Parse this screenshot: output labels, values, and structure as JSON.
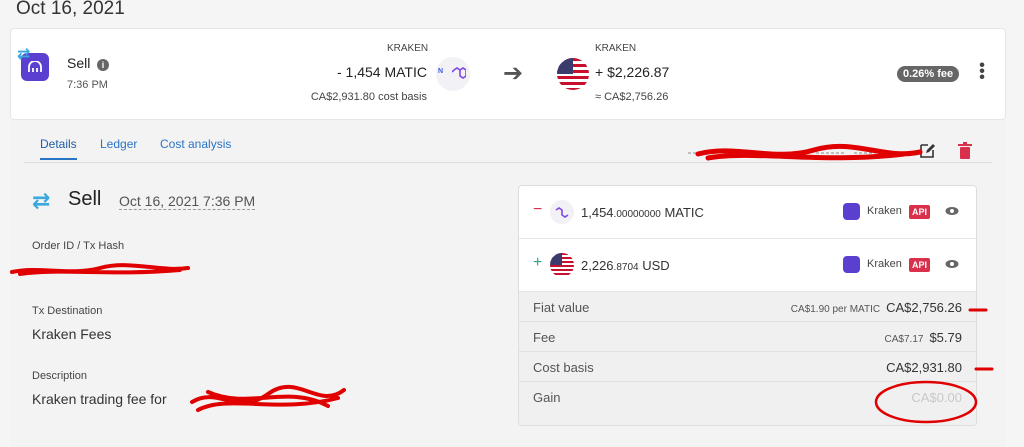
{
  "date_heading": "Oct 16, 2021",
  "summary": {
    "type": "Sell",
    "time": "7:36 PM",
    "from": {
      "exchange": "KRAKEN",
      "amount": "- 1,454 MATIC",
      "basis": "CA$2,931.80 cost basis"
    },
    "to": {
      "exchange": "KRAKEN",
      "amount": "+ $2,226.87",
      "approx": "≈ CA$2,756.26"
    },
    "fee_badge": "0.26% fee",
    "arrow": "➔",
    "kebab": "⋮"
  },
  "tabs": [
    {
      "label": "Details",
      "active": true
    },
    {
      "label": "Ledger",
      "active": false
    },
    {
      "label": "Cost analysis",
      "active": false
    }
  ],
  "detail": {
    "type": "Sell",
    "datetime": "Oct 16, 2021 7:36 PM",
    "fields": {
      "order_label": "Order ID / Tx Hash",
      "destination_label": "Tx Destination",
      "destination_value": "Kraken Fees",
      "description_label": "Description",
      "description_value": "Kraken trading fee for "
    }
  },
  "panel": {
    "sent": {
      "sign": "−",
      "amount_main": "1,454",
      "amount_decimals": ".00000000",
      "currency": "MATIC",
      "wallet": "Kraken",
      "api": "API"
    },
    "received": {
      "sign": "+",
      "amount_main": "2,226",
      "amount_decimals": ".8704",
      "currency": "USD",
      "wallet": "Kraken",
      "api": "API"
    },
    "rows": [
      {
        "label": "Fiat value",
        "sub": "CA$1.90 per MATIC",
        "value": "CA$2,756.26"
      },
      {
        "label": "Fee",
        "sub": "CA$7.17",
        "value": "$5.79"
      },
      {
        "label": "Cost basis",
        "sub": "",
        "value": "CA$2,931.80"
      },
      {
        "label": "Gain",
        "sub": "",
        "value": "CA$0.00"
      }
    ]
  },
  "colors": {
    "accent": "#2a74c5",
    "kraken": "#5b3fd0",
    "api_badge": "#d9304c",
    "sell_arrows": "#3aa9e0",
    "annotation": "#e00000"
  }
}
